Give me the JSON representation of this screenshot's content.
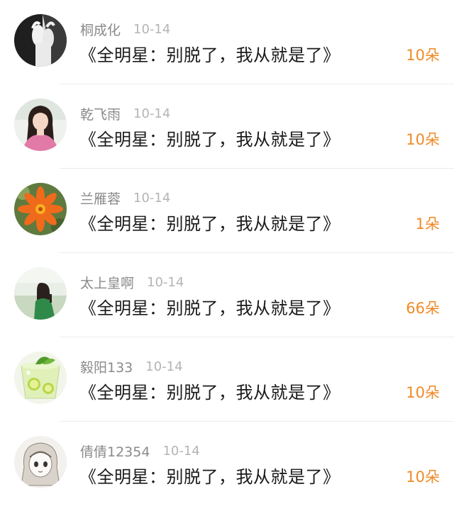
{
  "colors": {
    "name": "#8a8a8a",
    "date": "#b4b4b4",
    "title": "#1a1a1a",
    "count": "#f08a25"
  },
  "items": [
    {
      "avatar": "avatar-hands-bw",
      "name": "桐成化",
      "date": "10-14",
      "title": "《全明星：别脱了，我从就是了》",
      "count": "10朵"
    },
    {
      "avatar": "avatar-girl-pink",
      "name": "乾飞雨",
      "date": "10-14",
      "title": "《全明星：别脱了，我从就是了》",
      "count": "10朵"
    },
    {
      "avatar": "avatar-orange-flower",
      "name": "兰雁蓉",
      "date": "10-14",
      "title": "《全明星：别脱了，我从就是了》",
      "count": "1朵"
    },
    {
      "avatar": "avatar-girl-green-coat",
      "name": "太上皇啊",
      "date": "10-14",
      "title": "《全明星：别脱了，我从就是了》",
      "count": "66朵"
    },
    {
      "avatar": "avatar-lime-drink",
      "name": "毅阳133",
      "date": "10-14",
      "title": "《全明星：别脱了，我从就是了》",
      "count": "10朵"
    },
    {
      "avatar": "avatar-sketch-girl",
      "name": "倩倩12354",
      "date": "10-14",
      "title": "《全明星：别脱了，我从就是了》",
      "count": "10朵"
    }
  ]
}
